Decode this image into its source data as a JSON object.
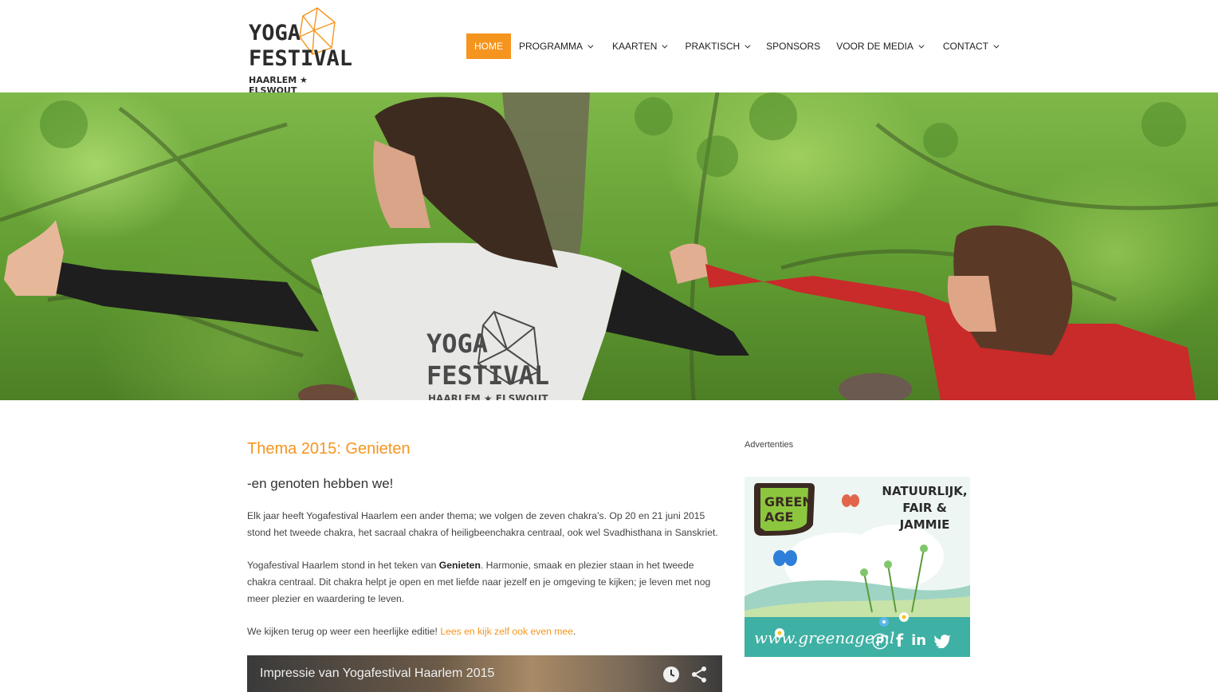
{
  "logo": {
    "line1": "YOGA",
    "line2": "FESTIVAL",
    "line3": "HAARLEM ★ ELSWOUT"
  },
  "nav": {
    "items": [
      {
        "label": "HOME",
        "active": true,
        "dropdown": false
      },
      {
        "label": "PROGRAMMA",
        "active": false,
        "dropdown": true
      },
      {
        "label": "KAARTEN",
        "active": false,
        "dropdown": true
      },
      {
        "label": "PRAKTISCH",
        "active": false,
        "dropdown": true
      },
      {
        "label": "SPONSORS",
        "active": false,
        "dropdown": false
      },
      {
        "label": "VOOR DE MEDIA",
        "active": false,
        "dropdown": true
      },
      {
        "label": "CONTACT",
        "active": false,
        "dropdown": true
      }
    ],
    "accent_color": "#f5951f"
  },
  "hero": {
    "shirt_line1": "YOGA",
    "shirt_line2": "FESTIVAL",
    "shirt_line3": "HAARLEM ★ ELSWOUT"
  },
  "article": {
    "title": "Thema 2015: Genieten",
    "subtitle": "-en genoten hebben we!",
    "p1": "Elk jaar heeft Yogafestival Haarlem een ander thema; we volgen de zeven chakra’s. Op 20 en 21 juni 2015 stond het tweede chakra, het sacraal chakra of heiligbeenchakra centraal, ook wel Svadhisthana in Sanskriet.",
    "p2_before": "Yogafestival Haarlem stond in het teken van ",
    "p2_bold": "Genieten",
    "p2_after": ". Harmonie, smaak en plezier staan in het tweede chakra centraal. Dit chakra helpt je open en met liefde naar jezelf en je omgeving te kijken; je leven met nog meer plezier en waardering te leven.",
    "p3_before": "We kijken terug op weer een heerlijke editie! ",
    "p3_link": "Lees en kijk zelf ook even mee",
    "p3_after": "."
  },
  "video": {
    "title": "Impressie van Yogafestival Haarlem 2015",
    "icons": [
      "clock-icon",
      "share-icon"
    ]
  },
  "sidebar": {
    "ad_label": "Advertenties",
    "ad": {
      "brand_line1": "GREEN",
      "brand_line2": "AGE",
      "slogan1": "NATUURLIJK,",
      "slogan2": "FAIR &",
      "slogan3": "JAMMIE",
      "url": "www.greenage.nl",
      "social": [
        "pinterest-icon",
        "facebook-icon",
        "linkedin-icon",
        "twitter-icon"
      ]
    }
  }
}
